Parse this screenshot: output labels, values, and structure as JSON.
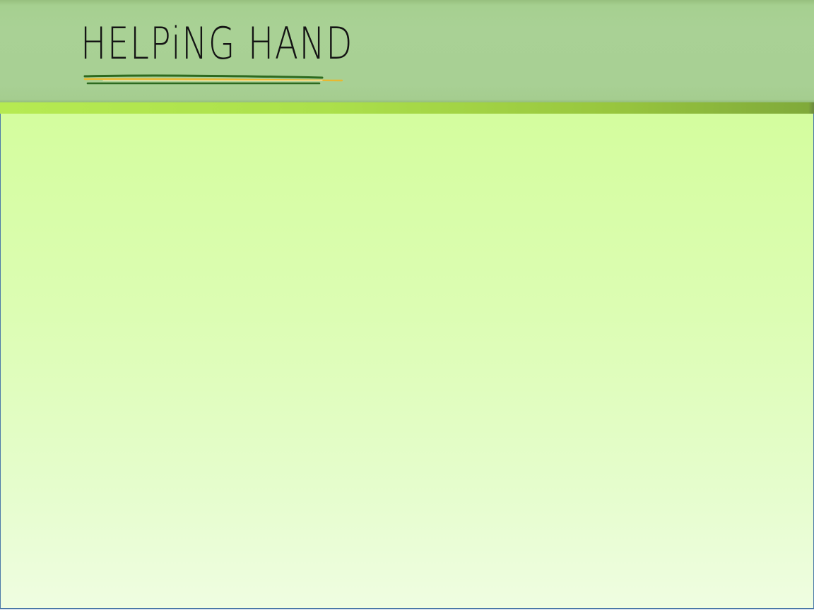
{
  "slide": {
    "title": "HELPiNG HAND"
  },
  "colors": {
    "header_band": "#a8d094",
    "accent_bar": "#b0e24d",
    "content_top": "#d4fd9e",
    "content_bottom": "#effde1",
    "title_text": "#141414",
    "underline_dark": "#2d6a1f",
    "underline_gold": "#e8b830",
    "frame_border": "#4a78a8"
  }
}
